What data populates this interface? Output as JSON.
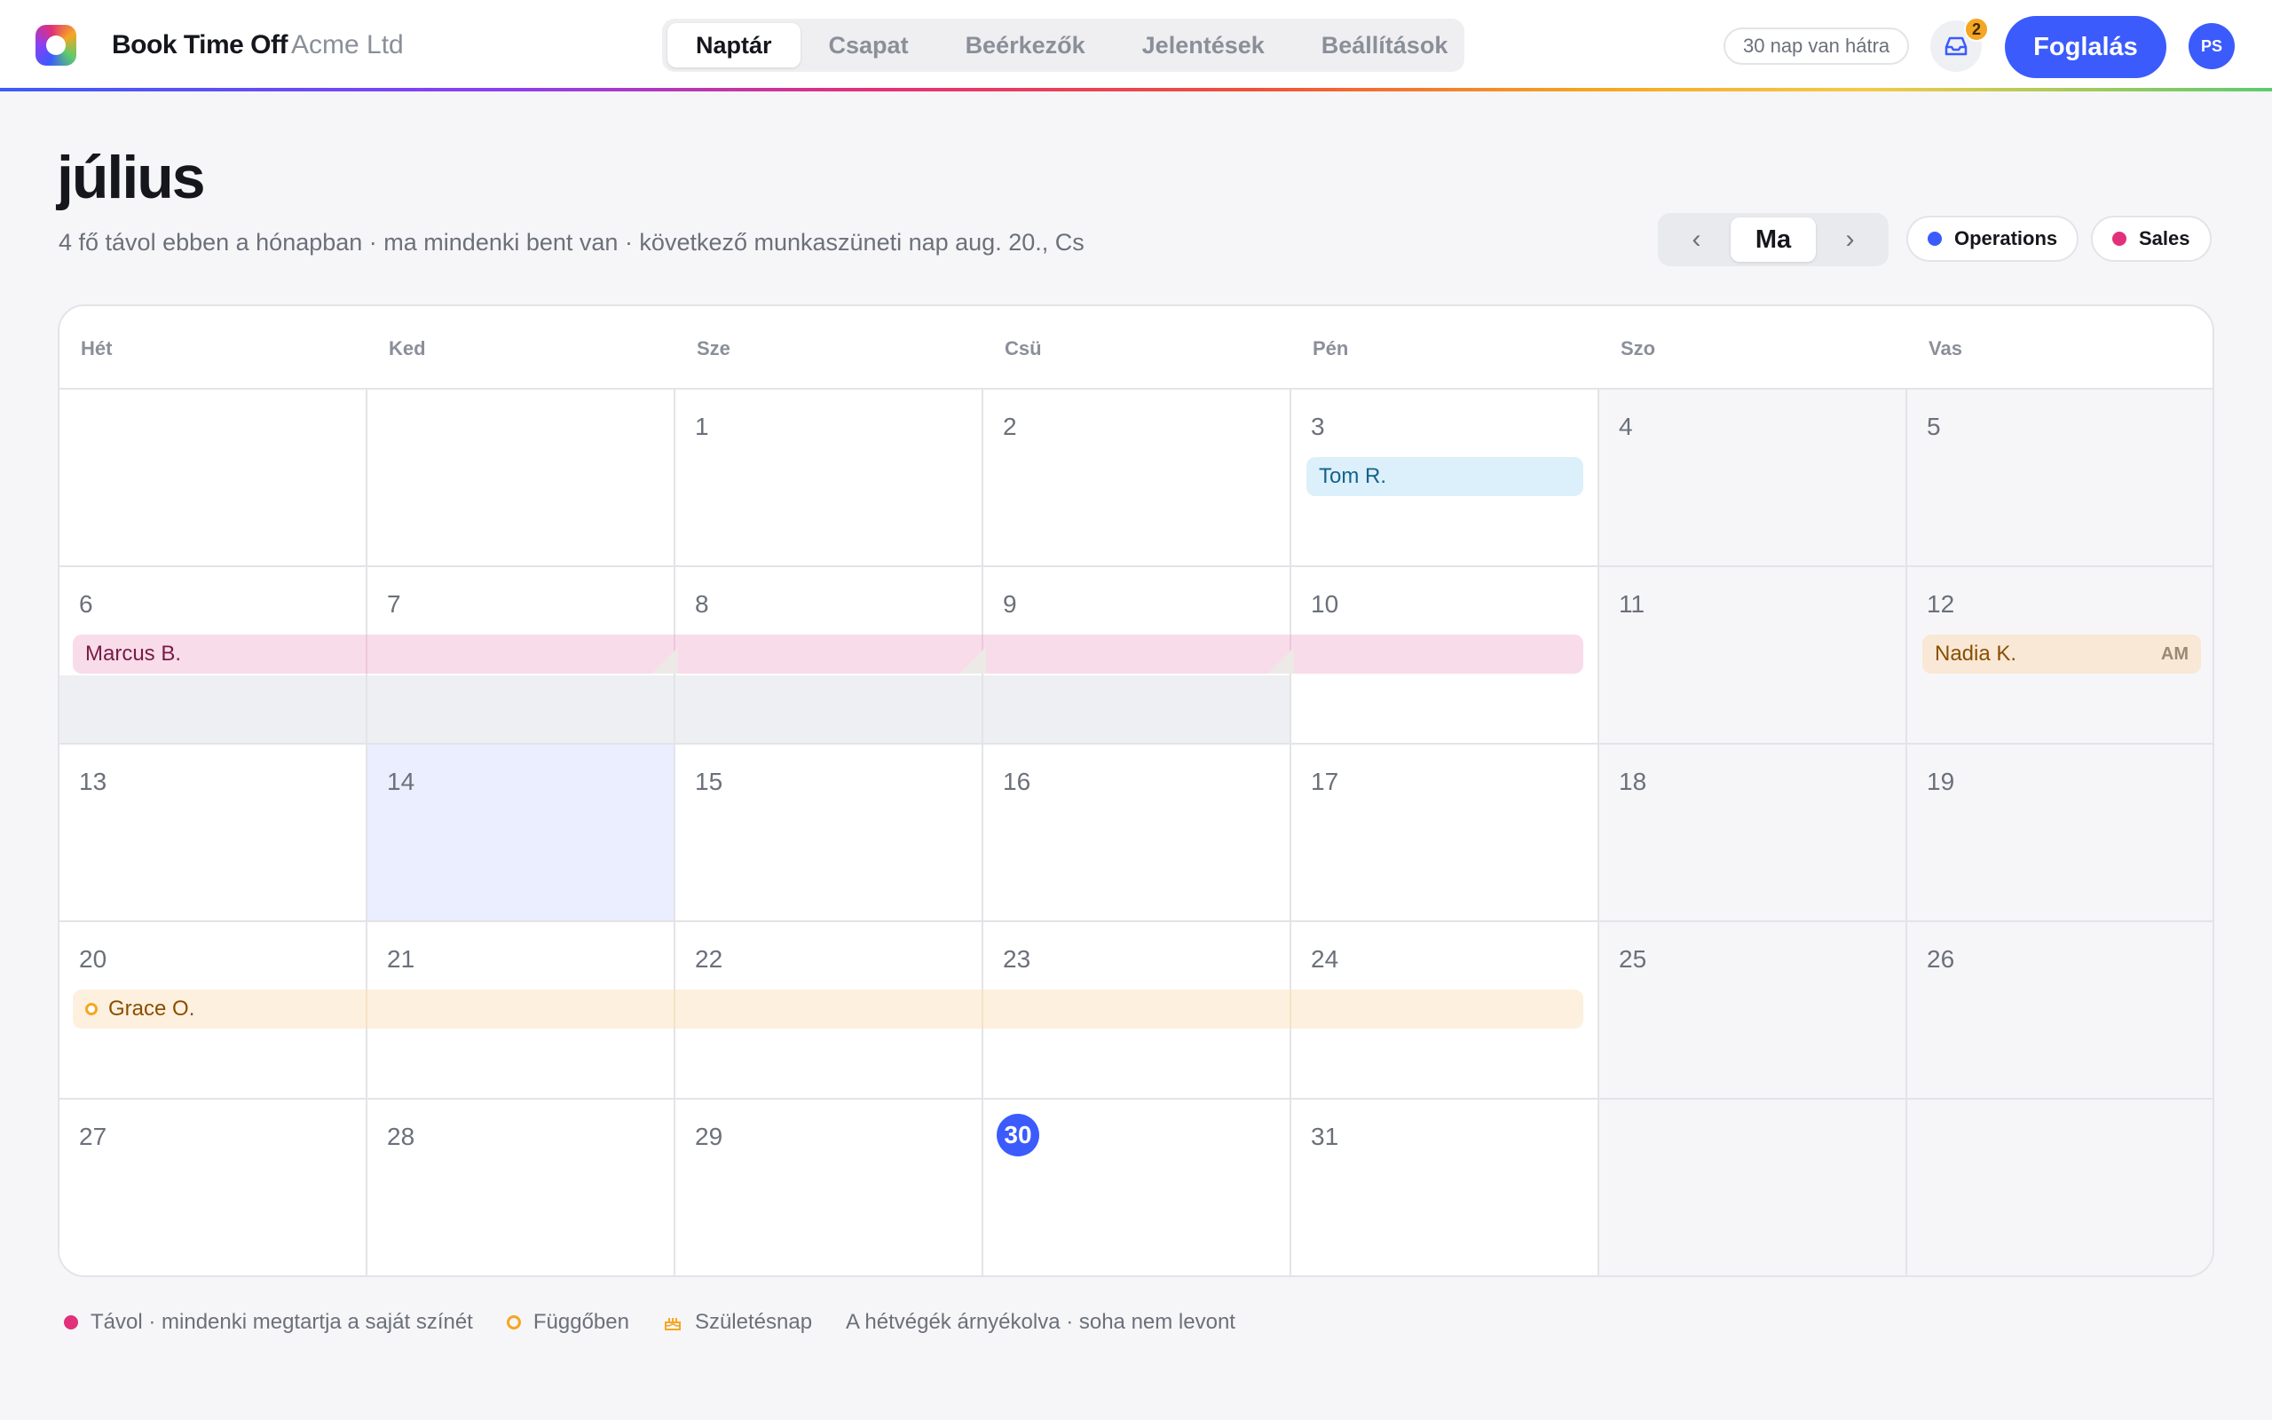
{
  "app": {
    "brand": "Book Time Off",
    "company": "Acme Ltd",
    "tabs": [
      {
        "label": "Naptár",
        "active": true
      },
      {
        "label": "Csapat"
      },
      {
        "label": "Beérkezők"
      },
      {
        "label": "Jelentések"
      },
      {
        "label": "Beállítások"
      }
    ],
    "days_left": "30 nap van hátra",
    "inbox_count": "2",
    "book_label": "Foglalás",
    "avatar_initials": "PS"
  },
  "header": {
    "month": "július",
    "subtitle": "4 fő távol ebben a hónapban · ma mindenki bent van · következő munkaszüneti nap aug. 20., Cs",
    "today_label": "Ma",
    "prev_icon": "‹",
    "next_icon": "›",
    "teams": [
      {
        "label": "Operations",
        "color": "#3b5bfd"
      },
      {
        "label": "Sales",
        "color": "#e2307a"
      }
    ]
  },
  "calendar": {
    "weekdays": [
      "Hét",
      "Ked",
      "Sze",
      "Csü",
      "Pén",
      "Szo",
      "Vas"
    ],
    "weeks": [
      [
        "",
        "",
        "1",
        "2",
        "3",
        "4",
        "5"
      ],
      [
        "6",
        "7",
        "8",
        "9",
        "10",
        "11",
        "12"
      ],
      [
        "13",
        "14",
        "15",
        "16",
        "17",
        "18",
        "19"
      ],
      [
        "20",
        "21",
        "22",
        "23",
        "24",
        "25",
        "26"
      ],
      [
        "27",
        "28",
        "29",
        "30",
        "31",
        "",
        ""
      ]
    ],
    "today": "30",
    "events": [
      {
        "name": "Tom R.",
        "color": "blue"
      },
      {
        "name": "Marcus B.",
        "color": "pink"
      },
      {
        "name": "Nadia K.",
        "color": "peach",
        "badge": "AM"
      },
      {
        "name": "Grace O.",
        "color": "pending"
      }
    ]
  },
  "legend": {
    "away": "Távol · mindenki megtartja a saját színét",
    "pending": "Függőben",
    "birthday": "Születésnap",
    "weekends": "A hétvégék árnyékolva · soha nem levont",
    "away_color": "#e2307a",
    "pending_color": "#f5a623"
  }
}
